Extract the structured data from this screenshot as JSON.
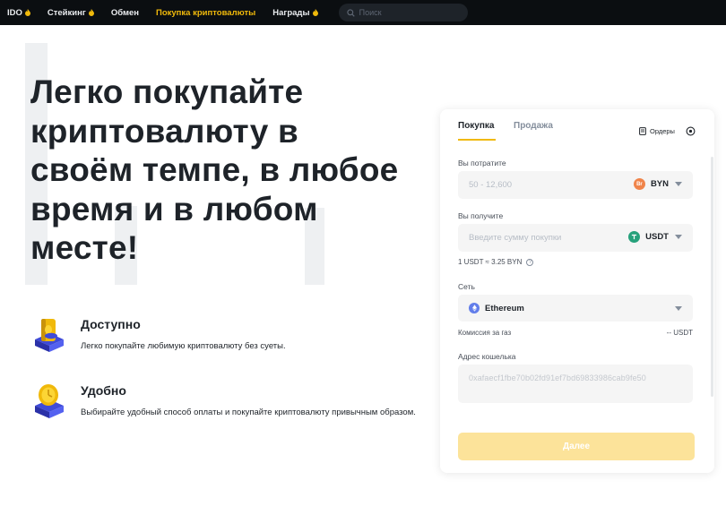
{
  "nav": {
    "items": [
      {
        "label": "IDO",
        "fire": true,
        "active": false
      },
      {
        "label": "Стейкинг",
        "fire": true,
        "active": false
      },
      {
        "label": "Обмен",
        "fire": false,
        "active": false
      },
      {
        "label": "Покупка криптовалюты",
        "fire": false,
        "active": true
      },
      {
        "label": "Награды",
        "fire": true,
        "active": false
      }
    ],
    "search_placeholder": "Поиск"
  },
  "hero": {
    "title_lines": [
      "Легко покупайте",
      "криптовалюту в",
      "своём темпе, в любое",
      "время и в любом",
      "месте!"
    ]
  },
  "features": [
    {
      "title": "Доступно",
      "text": "Легко покупайте любимую криптовалюту без суеты.",
      "icon": "coin-stack-icon"
    },
    {
      "title": "Удобно",
      "text": "Выбирайте удобный способ оплаты и покупайте криптовалюту привычным образом.",
      "icon": "clock-coin-icon"
    }
  ],
  "card": {
    "tabs": {
      "buy": "Покупка",
      "sell": "Продажа"
    },
    "orders_label": "Ордеры",
    "spend": {
      "label": "Вы потратите",
      "placeholder": "50 - 12,600",
      "currency": "BYN",
      "coin_glyph": "Br",
      "coin_color": "#f0844a"
    },
    "receive": {
      "label": "Вы получите",
      "placeholder": "Введите сумму покупки",
      "currency": "USDT",
      "coin_color": "#26a17b"
    },
    "rate": "1 USDT ≈ 3.25 BYN",
    "network": {
      "label": "Сеть",
      "value": "Ethereum"
    },
    "fee": {
      "label": "Комиссия за газ",
      "value": "-- USDT"
    },
    "wallet": {
      "label": "Адрес кошелька",
      "value": "0xafaecf1fbe70b02fd91ef7bd69833986cab9fe50"
    },
    "submit": "Далее"
  },
  "colors": {
    "accent": "#f0b90b",
    "nav_bg": "#0b0e11",
    "submit_disabled": "#fce39a"
  }
}
